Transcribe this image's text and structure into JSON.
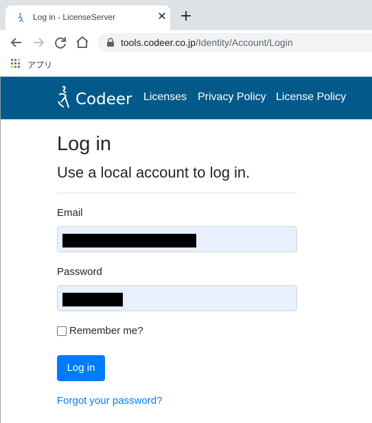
{
  "browser": {
    "tab": {
      "title": "Log in - LicenseServer",
      "close_glyph": "✕",
      "favicon": "codeer-icon"
    },
    "new_tab_glyph": "+",
    "url": {
      "host": "tools.codeer.co.jp",
      "path": "/Identity/Account/Login"
    },
    "bookmarks": {
      "apps_label": "アプリ"
    }
  },
  "navbar": {
    "brand": "Codeer",
    "links": [
      "Licenses",
      "Privacy Policy",
      "License Policy"
    ],
    "background": "#035a8a"
  },
  "page": {
    "title": "Log in",
    "subtitle": "Use a local account to log in.",
    "email_label": "Email",
    "password_label": "Password",
    "remember_label": "Remember me?",
    "login_button": "Log in",
    "forgot_link": "Forgot your password?"
  },
  "colors": {
    "primary": "#007bff",
    "autofill": "#e8f0fe"
  }
}
